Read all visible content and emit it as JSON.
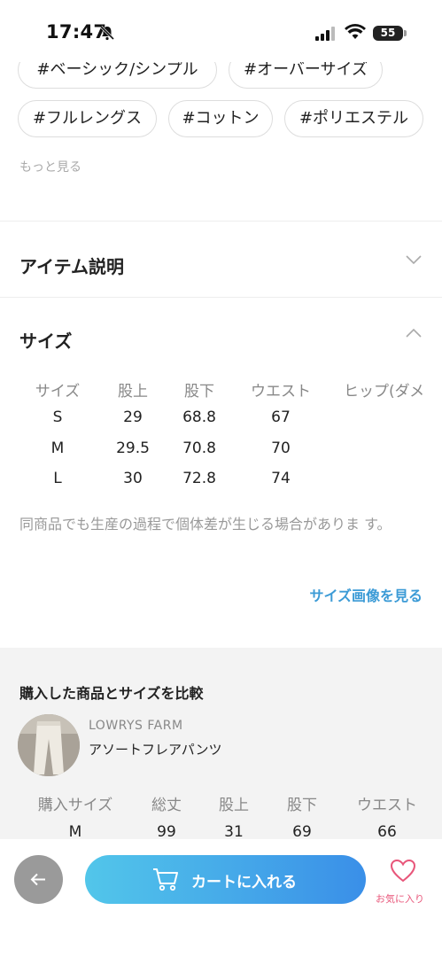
{
  "status_bar": {
    "time": "17:47",
    "battery": "55"
  },
  "tags": {
    "row1": [
      "#ベーシック/シンプル",
      "#オーバーサイズ"
    ],
    "row2": [
      "#フルレングス",
      "#コットン",
      "#ポリエステル"
    ],
    "more_label": "もっと見る"
  },
  "item_description": {
    "title": "アイテム説明"
  },
  "size_section": {
    "title": "サイズ",
    "headers": [
      "サイズ",
      "股上",
      "股下",
      "ウエスト",
      "ヒップ(ダメ"
    ],
    "rows": [
      [
        "S",
        "29",
        "68.8",
        "67"
      ],
      [
        "M",
        "29.5",
        "70.8",
        "70"
      ],
      [
        "L",
        "30",
        "72.8",
        "74"
      ]
    ],
    "note": "同商品でも生産の過程で個体差が生じる場合がありま す。",
    "size_image_link": "サイズ画像を見る"
  },
  "compare": {
    "title": "購入した商品とサイズを比較",
    "brand": "LOWRYS FARM",
    "product_name": "アソートフレアパンツ",
    "headers": [
      "購入サイズ",
      "総丈",
      "股上",
      "股下",
      "ウエスト"
    ],
    "row": [
      "M",
      "99",
      "31",
      "69",
      "66"
    ]
  },
  "bottom_bar": {
    "cart_label": "カートに入れる",
    "favorite_label": "お気に入り"
  },
  "colors": {
    "accent_blue": "#3c9bd6",
    "cart_gradient_start": "#52c6ea",
    "cart_gradient_end": "#3a8fe8",
    "favorite_pink": "#e8567a"
  }
}
